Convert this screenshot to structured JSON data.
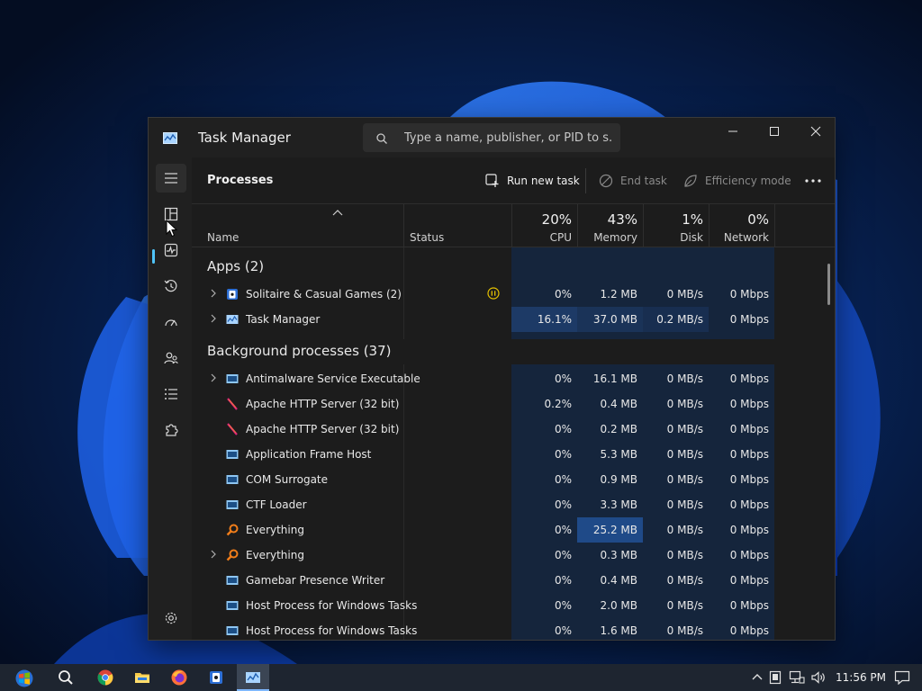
{
  "window": {
    "title": "Task Manager",
    "search_placeholder": "Type a name, publisher, or PID to s..."
  },
  "nav": {
    "items": [
      "menu",
      "processes",
      "performance",
      "app-history",
      "startup-apps",
      "users",
      "details",
      "services"
    ],
    "active": "processes"
  },
  "toolbar": {
    "page_title": "Processes",
    "run_new_task": "Run new task",
    "end_task": "End task",
    "efficiency_mode": "Efficiency mode"
  },
  "columns": {
    "name": "Name",
    "status": "Status",
    "cpu_pct": "20%",
    "cpu": "CPU",
    "memory_pct": "43%",
    "memory": "Memory",
    "disk_pct": "1%",
    "disk": "Disk",
    "network_pct": "0%",
    "network": "Network"
  },
  "groups": {
    "apps": "Apps (2)",
    "background": "Background processes (37)"
  },
  "apps": [
    {
      "name": "Solitaire & Casual Games (2)",
      "cpu": "0%",
      "memory": "1.2 MB",
      "disk": "0 MB/s",
      "network": "0 Mbps"
    },
    {
      "name": "Task Manager",
      "cpu": "16.1%",
      "memory": "37.0 MB",
      "disk": "0.2 MB/s",
      "network": "0 Mbps"
    }
  ],
  "background": [
    {
      "name": "Antimalware Service Executable",
      "cpu": "0%",
      "memory": "16.1 MB",
      "disk": "0 MB/s",
      "network": "0 Mbps"
    },
    {
      "name": "Apache HTTP Server (32 bit)",
      "cpu": "0.2%",
      "memory": "0.4 MB",
      "disk": "0 MB/s",
      "network": "0 Mbps"
    },
    {
      "name": "Apache HTTP Server (32 bit)",
      "cpu": "0%",
      "memory": "0.2 MB",
      "disk": "0 MB/s",
      "network": "0 Mbps"
    },
    {
      "name": "Application Frame Host",
      "cpu": "0%",
      "memory": "5.3 MB",
      "disk": "0 MB/s",
      "network": "0 Mbps"
    },
    {
      "name": "COM Surrogate",
      "cpu": "0%",
      "memory": "0.9 MB",
      "disk": "0 MB/s",
      "network": "0 Mbps"
    },
    {
      "name": "CTF Loader",
      "cpu": "0%",
      "memory": "3.3 MB",
      "disk": "0 MB/s",
      "network": "0 Mbps"
    },
    {
      "name": "Everything",
      "cpu": "0%",
      "memory": "25.2 MB",
      "disk": "0 MB/s",
      "network": "0 Mbps"
    },
    {
      "name": "Everything",
      "cpu": "0%",
      "memory": "0.3 MB",
      "disk": "0 MB/s",
      "network": "0 Mbps"
    },
    {
      "name": "Gamebar Presence Writer",
      "cpu": "0%",
      "memory": "0.4 MB",
      "disk": "0 MB/s",
      "network": "0 Mbps"
    },
    {
      "name": "Host Process for Windows Tasks",
      "cpu": "0%",
      "memory": "2.0 MB",
      "disk": "0 MB/s",
      "network": "0 Mbps"
    },
    {
      "name": "Host Process for Windows Tasks",
      "cpu": "0%",
      "memory": "1.6 MB",
      "disk": "0 MB/s",
      "network": "0 Mbps"
    }
  ],
  "taskbar": {
    "clock": "11:56 PM",
    "pinned": [
      "start-icon",
      "search-icon",
      "chrome-icon",
      "file-explorer-icon",
      "firefox-icon",
      "solitaire-icon",
      "task-manager-icon"
    ]
  },
  "colors": {
    "accent": "#4fc3f7",
    "heat_low": "#162a44",
    "heat_mid": "#1d3a66",
    "heat_high": "#1f4a88"
  }
}
